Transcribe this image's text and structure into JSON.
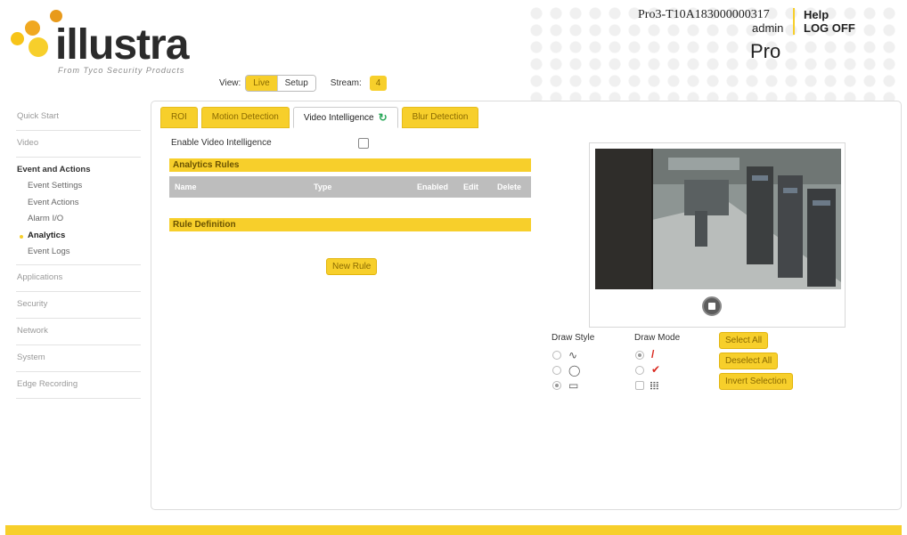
{
  "header": {
    "logo_text": "illustra",
    "logo_tagline": "From Tyco Security Products",
    "device_id": "Pro3-T10A183000000317",
    "user": "admin",
    "help": "Help",
    "log_off": "LOG OFF",
    "product": "Pro",
    "view_label": "View:",
    "view_live": "Live",
    "view_setup": "Setup",
    "stream_label": "Stream:",
    "stream_value": "4"
  },
  "sidebar": {
    "quick_start": "Quick Start",
    "video": "Video",
    "events_group": "Event and Actions",
    "events_items": [
      "Event Settings",
      "Event Actions",
      "Alarm I/O",
      "Analytics",
      "Event Logs"
    ],
    "active_item": "Analytics",
    "applications": "Applications",
    "security": "Security",
    "network": "Network",
    "system": "System",
    "edge_recording": "Edge Recording"
  },
  "tabs": [
    "ROI",
    "Motion Detection",
    "Video Intelligence",
    "Blur Detection"
  ],
  "active_tab": "Video Intelligence",
  "main": {
    "enable_label": "Enable Video Intelligence",
    "enable_checked": false,
    "analytics_rules": "Analytics Rules",
    "columns": [
      "Name",
      "Type",
      "Enabled",
      "Edit",
      "Delete"
    ],
    "rule_definition": "Rule Definition",
    "new_rule": "New Rule"
  },
  "draw": {
    "style_label": "Draw Style",
    "mode_label": "Draw Mode",
    "select_all": "Select All",
    "deselect_all": "Deselect All",
    "invert_selection": "Invert Selection"
  },
  "colors": {
    "accent": "#f7cf2b",
    "accent_text": "#8a6a00",
    "table_header": "#bdbdbd",
    "refresh_icon": "#2aa85a"
  }
}
